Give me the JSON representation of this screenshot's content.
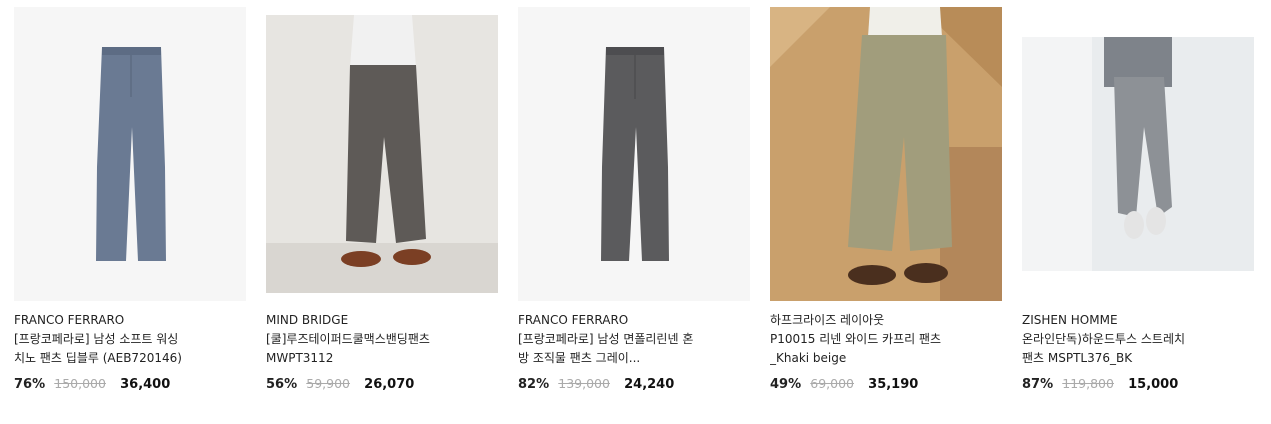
{
  "products": [
    {
      "brand": "FRANCO FERRARO",
      "name_line1": "[프랑코페라로] 남성 소프트 워싱",
      "name_line2": "치노 팬츠 딥블루 (AEB720146)",
      "discount": "76%",
      "original_price": "150,000",
      "sale_price": "36,400",
      "pants_color": "#6a7a93"
    },
    {
      "brand": "MIND BRIDGE",
      "name_line1": "[쿨]루즈테이퍼드쿨맥스밴딩팬츠",
      "name_line2": "MWPT3112",
      "discount": "56%",
      "original_price": "59,900",
      "sale_price": "26,070",
      "pants_color": "#5e5a57"
    },
    {
      "brand": "FRANCO FERRARO",
      "name_line1": "[프랑코페라로] 남성 면폴리린넨 혼",
      "name_line2": "방 조직물 팬츠 그레이...",
      "discount": "82%",
      "original_price": "139,000",
      "sale_price": "24,240",
      "pants_color": "#5b5b5d"
    },
    {
      "brand": "하프크라이즈 레이아웃",
      "name_line1": "P10015 리넨 와이드 카프리 팬츠",
      "name_line2": "_Khaki beige",
      "discount": "49%",
      "original_price": "69,000",
      "sale_price": "35,190",
      "pants_color": "#a19d7c"
    },
    {
      "brand": "ZISHEN HOMME",
      "name_line1": "온라인단독)하운드투스 스트레치",
      "name_line2": "팬츠 MSPTL376_BK",
      "discount": "87%",
      "original_price": "119,800",
      "sale_price": "15,000",
      "pants_color": "#8d9196"
    }
  ]
}
